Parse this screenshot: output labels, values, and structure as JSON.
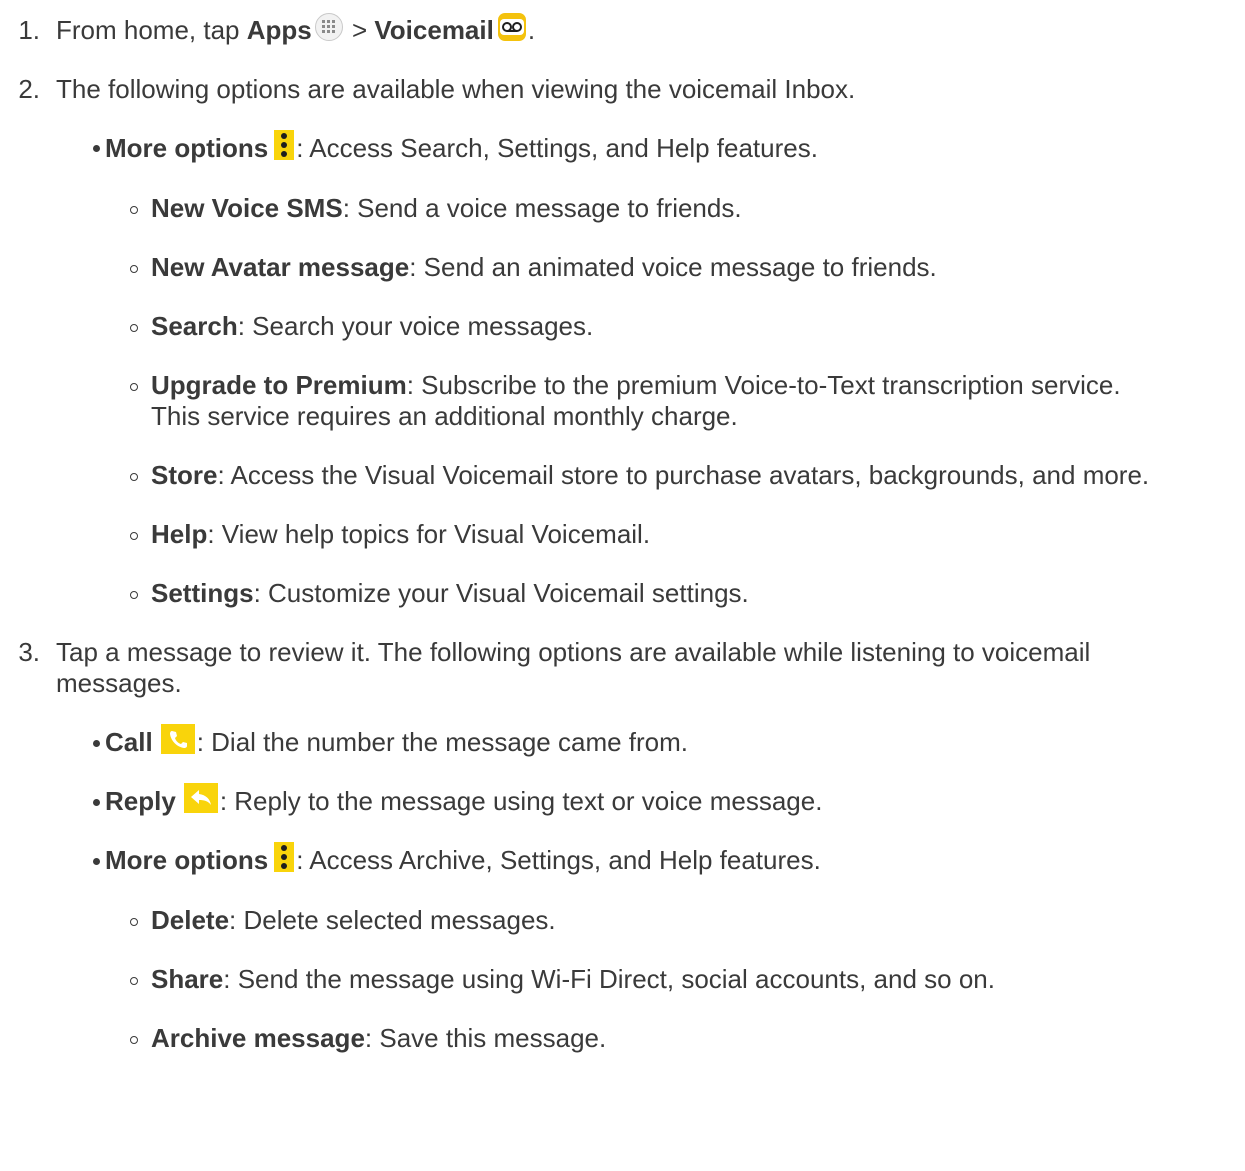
{
  "steps": [
    {
      "number": "1.",
      "pre": "From home, tap ",
      "apps_label": "Apps",
      "separator": " > ",
      "voicemail_label": "Voicemail",
      "post": "."
    },
    {
      "number": "2.",
      "text": "The following options are available when viewing the voicemail Inbox.",
      "bullets": [
        {
          "label": "More options",
          "desc": ": Access Search, Settings, and Help features.",
          "sub_items": [
            {
              "label": "New Voice SMS",
              "desc": ": Send a voice message to friends."
            },
            {
              "label": "New Avatar message",
              "desc": ": Send an animated voice message to friends."
            },
            {
              "label": "Search",
              "desc": ": Search your voice messages."
            },
            {
              "label": "Upgrade to Premium",
              "desc": ": Subscribe to the premium Voice-to-Text transcription service.",
              "desc_line2": "This service requires an additional monthly charge."
            },
            {
              "label": "Store",
              "desc": ": Access the Visual Voicemail store to purchase avatars, backgrounds, and more."
            },
            {
              "label": "Help",
              "desc": ": View help topics for Visual Voicemail."
            },
            {
              "label": "Settings",
              "desc": ": Customize your Visual Voicemail settings."
            }
          ]
        }
      ]
    },
    {
      "number": "3.",
      "text": "Tap a message to review it. The following options are available while listening to voicemail",
      "text_line2": "messages.",
      "bullets": [
        {
          "label": "Call",
          "desc": ": Dial the number the message came from."
        },
        {
          "label": "Reply",
          "desc": ": Reply to the message using text or voice message."
        },
        {
          "label": "More options",
          "desc": ": Access Archive, Settings, and Help features.",
          "sub_items": [
            {
              "label": "Delete",
              "desc": ": Delete selected messages."
            },
            {
              "label": "Share",
              "desc": ": Send the message using Wi-Fi Direct, social accounts, and so on."
            },
            {
              "label": "Archive message",
              "desc": ": Save this message."
            }
          ]
        }
      ]
    }
  ],
  "icons": {
    "apps": "apps-grid-icon",
    "voicemail": "voicemail-icon",
    "more_options": "more-options-icon",
    "call": "phone-call-icon",
    "reply": "reply-arrow-icon"
  },
  "colors": {
    "text": "#3a3a3a",
    "icon_yellow": "#f9d40b"
  }
}
